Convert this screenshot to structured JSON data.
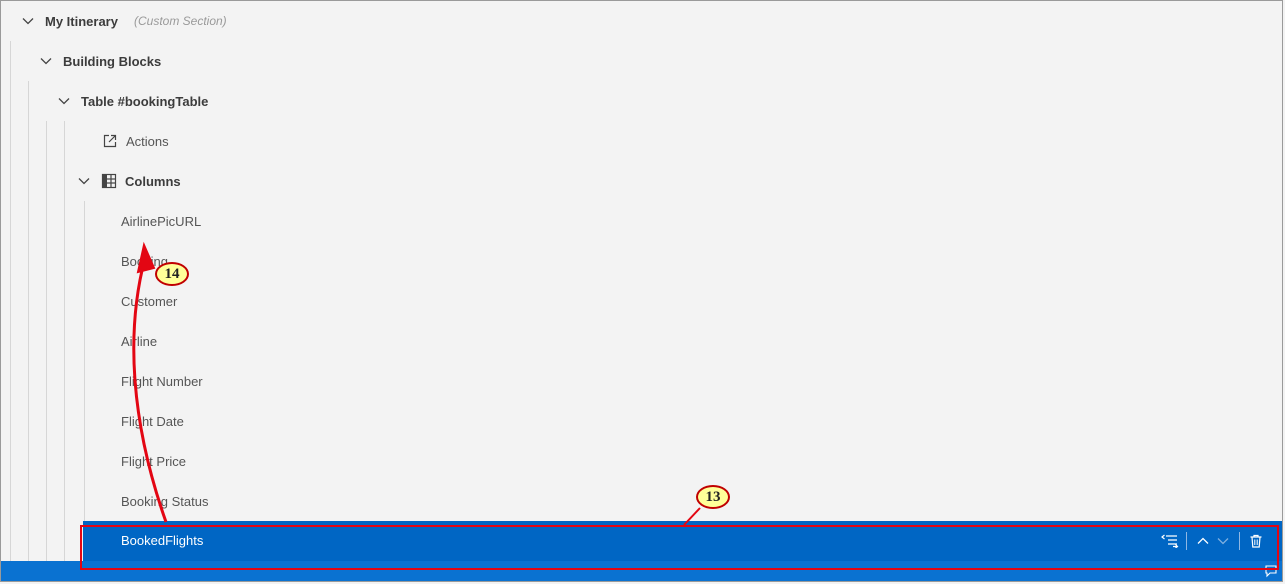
{
  "tree": {
    "section": {
      "label": "My Itinerary",
      "hint": "(Custom Section)"
    },
    "building_blocks": {
      "label": "Building Blocks"
    },
    "table": {
      "label": "Table #bookingTable"
    },
    "actions": {
      "label": "Actions"
    },
    "columns": {
      "label": "Columns",
      "items": [
        "AirlinePicURL",
        "Booking",
        "Customer",
        "Airline",
        "Flight Number",
        "Flight Date",
        "Flight Price",
        "Booking Status"
      ],
      "selected": "BookedFlights"
    }
  },
  "annotations": {
    "callout_13": "13",
    "callout_14": "14",
    "color": "#e30613"
  },
  "colors": {
    "selection": "#0066c4",
    "background": "#f3f3f3"
  }
}
